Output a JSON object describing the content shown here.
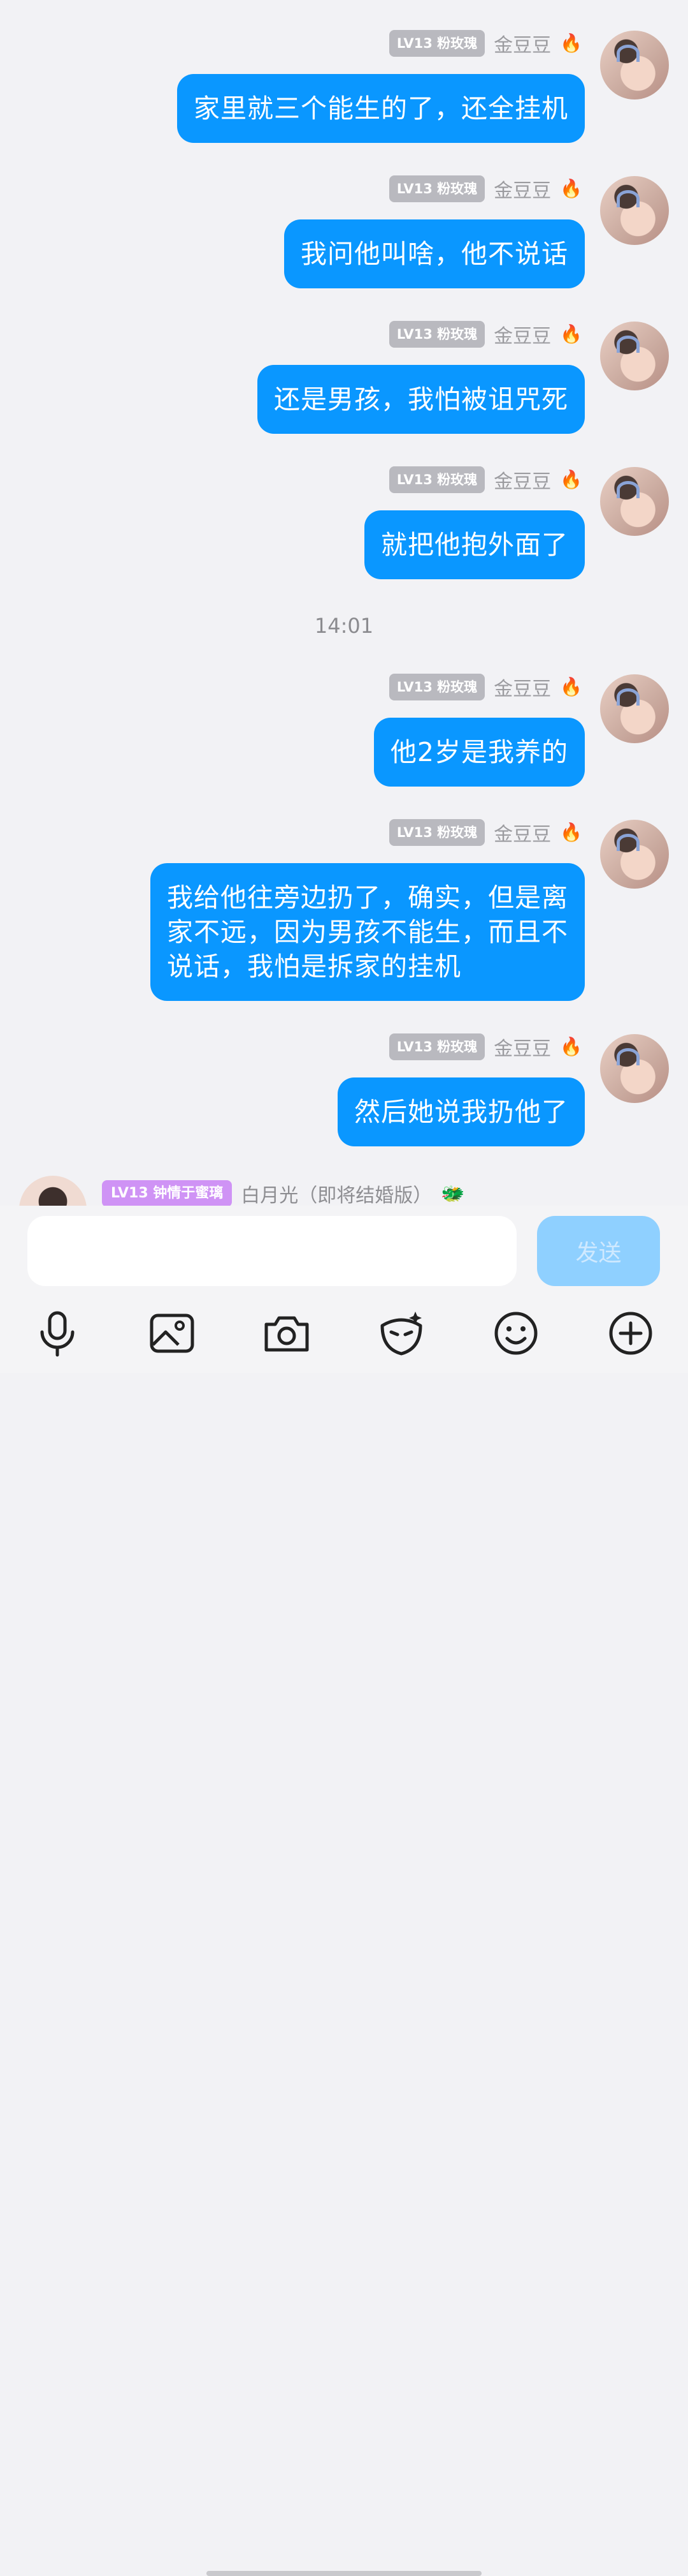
{
  "messages": [
    {
      "badge": "LV13 粉玫瑰",
      "name": "金豆豆",
      "lines": [
        "家里就三个能生的了，还全挂机"
      ]
    },
    {
      "badge": "LV13 粉玫瑰",
      "name": "金豆豆",
      "lines": [
        "我问他叫啥，他不说话"
      ]
    },
    {
      "badge": "LV13 粉玫瑰",
      "name": "金豆豆",
      "lines": [
        "还是男孩，我怕被诅咒死"
      ]
    },
    {
      "badge": "LV13 粉玫瑰",
      "name": "金豆豆",
      "lines": [
        "就把他抱外面了"
      ]
    },
    {
      "badge": "LV13 粉玫瑰",
      "name": "金豆豆",
      "lines": [
        "他2岁是我养的"
      ]
    },
    {
      "badge": "LV13 粉玫瑰",
      "name": "金豆豆",
      "lines": [
        "我给他往旁边扔了，确实，但是离",
        "家不远，因为男孩不能生，而且不",
        "说话，我怕是拆家的挂机"
      ]
    },
    {
      "badge": "LV13 粉玫瑰",
      "name": "金豆豆",
      "lines": [
        "然后她说我扔他了"
      ]
    }
  ],
  "timestamp": "14:01",
  "other_user": {
    "badge": "LV13 钟情于蜜璃",
    "name": "白月光（即将结婚版）"
  },
  "input": {
    "placeholder": "",
    "value": ""
  },
  "send_label": "发送",
  "colors": {
    "bubble": "#0a97ff",
    "send_disabled": "#8fd0ff",
    "badge_grey": "#b9b9bf",
    "badge_purple": "#cf93f5"
  },
  "toolbar_icons": [
    "mic-icon",
    "image-icon",
    "camera-icon",
    "sticker-icon",
    "emoji-icon",
    "plus-icon"
  ]
}
